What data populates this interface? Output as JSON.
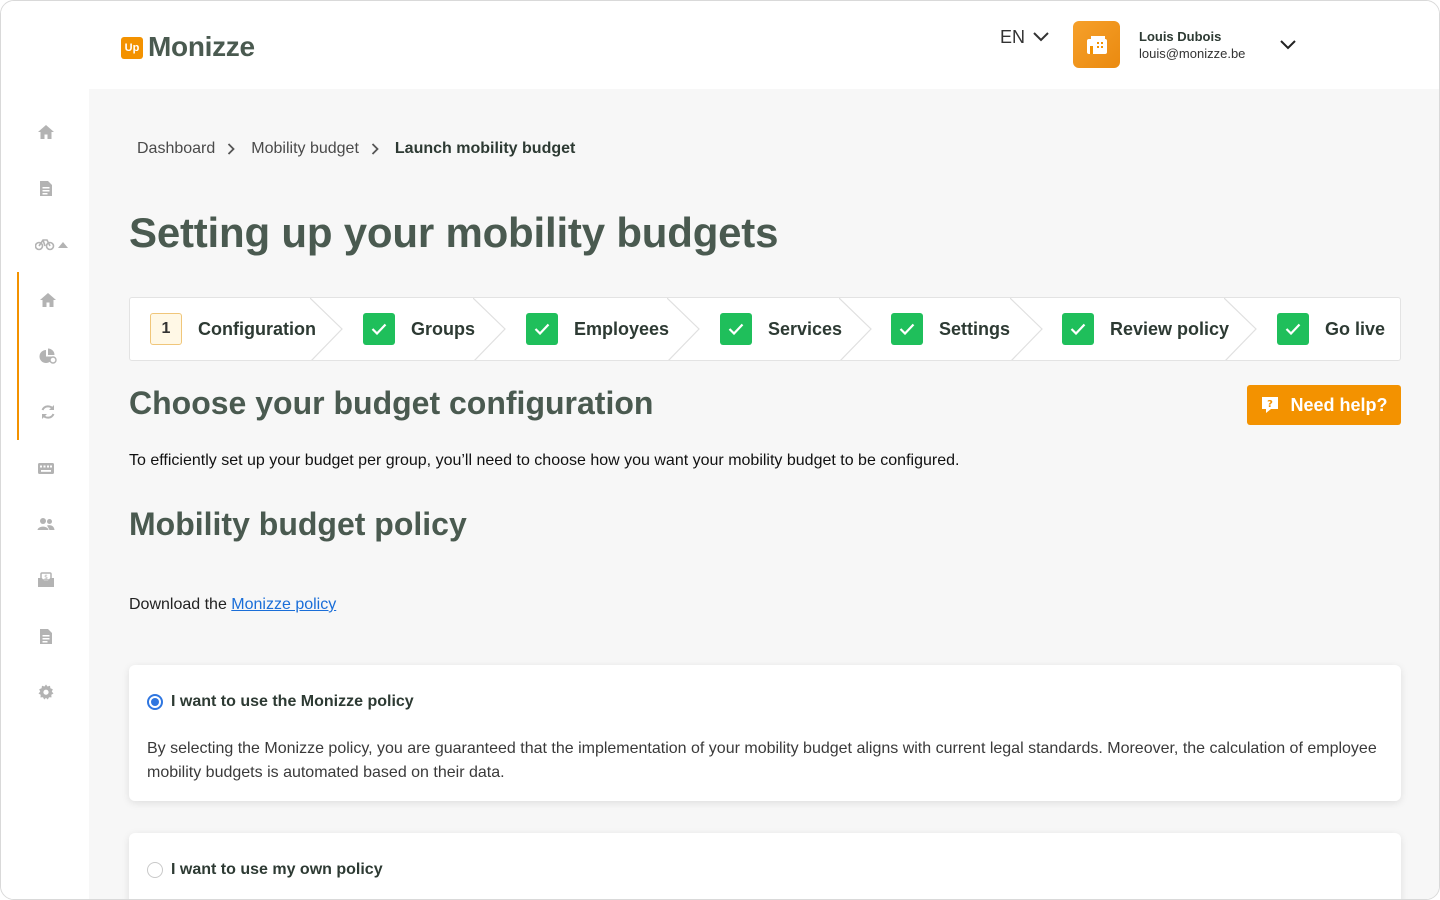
{
  "brand": {
    "badge": "Up",
    "name": "Monizze",
    "accent": "#f39200"
  },
  "header": {
    "language": "EN",
    "user": {
      "name": "Louis Dubois",
      "email": "louis@monizze.be"
    }
  },
  "sidebar": {
    "items": [
      {
        "icon": "home-icon"
      },
      {
        "icon": "document-icon"
      },
      {
        "icon": "bike-icon"
      },
      {
        "icon": "home-icon"
      },
      {
        "icon": "pie-chart-icon"
      },
      {
        "icon": "refresh-icon"
      },
      {
        "icon": "keyboard-icon"
      },
      {
        "icon": "users-icon"
      },
      {
        "icon": "money-inbox-icon"
      },
      {
        "icon": "document-icon"
      },
      {
        "icon": "gear-icon"
      }
    ]
  },
  "breadcrumb": [
    "Dashboard",
    "Mobility budget",
    "Launch mobility budget"
  ],
  "page_title": "Setting up your mobility budgets",
  "stepper": {
    "steps": [
      {
        "label": "Configuration",
        "number": "1",
        "state": "current"
      },
      {
        "label": "Groups",
        "state": "done"
      },
      {
        "label": "Employees",
        "state": "done"
      },
      {
        "label": "Services",
        "state": "done"
      },
      {
        "label": "Settings",
        "state": "done"
      },
      {
        "label": "Review policy",
        "state": "done"
      },
      {
        "label": "Go live",
        "state": "done"
      }
    ],
    "done_color": "#1fbf5b"
  },
  "config": {
    "title": "Choose your budget configuration",
    "help_button": "Need help?",
    "intro": "To efficiently set up your budget per group, you’ll need to choose how you want your mobility budget to be configured."
  },
  "policy": {
    "title": "Mobility budget policy",
    "download_prefix": "Download the",
    "download_link": "Monizze policy",
    "options": [
      {
        "label": "I want to use the Monizze policy",
        "selected": true,
        "description": "By selecting the Monizze policy, you are guaranteed that the implementation of your mobility budget aligns with current legal standards. Moreover, the calculation of employee mobility budgets is automated based on their data."
      },
      {
        "label": "I want to use my own policy",
        "selected": false
      }
    ]
  }
}
